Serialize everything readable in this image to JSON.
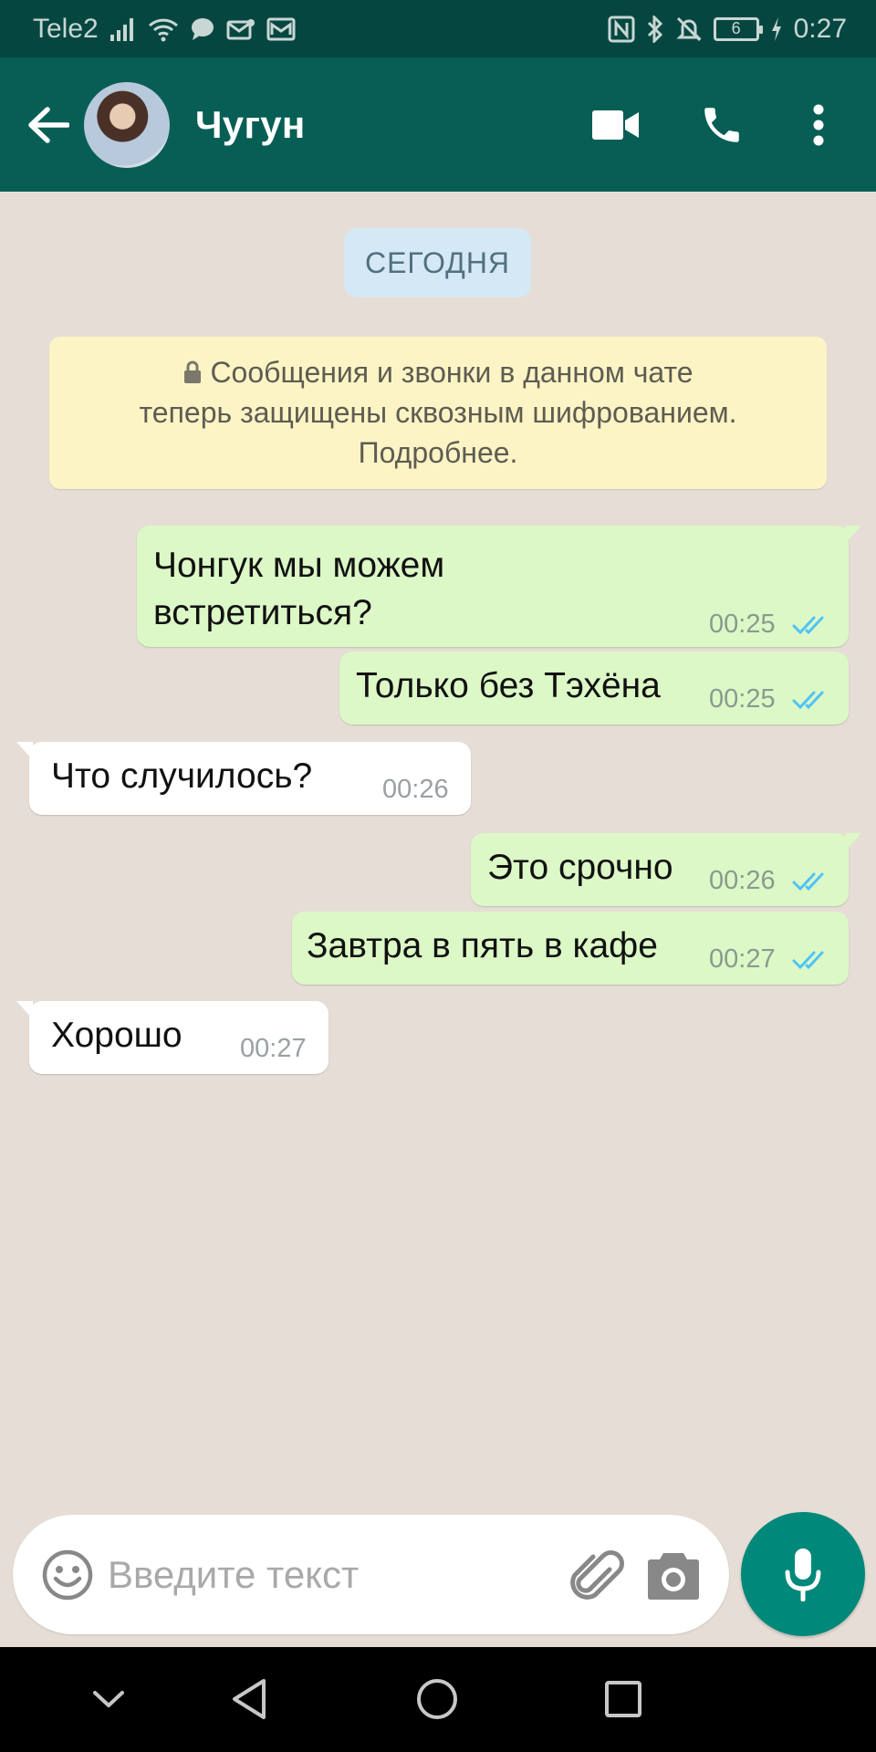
{
  "status_bar": {
    "carrier": "Tele2",
    "time": "0:27",
    "battery_level": "6"
  },
  "header": {
    "contact_name": "Чугун"
  },
  "chat": {
    "date_chip": "СЕГОДНЯ",
    "encryption_notice": {
      "line1": "Сообщения и звонки в данном чате",
      "line2": "теперь защищены сквозным шифрованием.",
      "line3": "Подробнее."
    },
    "messages": [
      {
        "direction": "out",
        "line1": "Чонгук мы можем",
        "line2": "встретиться?",
        "time": "00:25",
        "status": "read"
      },
      {
        "direction": "out",
        "line1": "Только без Тэхёна",
        "time": "00:25",
        "status": "read"
      },
      {
        "direction": "in",
        "line1": "Что случилось?",
        "time": "00:26"
      },
      {
        "direction": "out",
        "line1": "Это срочно",
        "time": "00:26",
        "status": "read"
      },
      {
        "direction": "out",
        "line1": "Завтра в пять в кафе",
        "time": "00:27",
        "status": "read"
      },
      {
        "direction": "in",
        "line1": "Хорошо",
        "time": "00:27"
      }
    ]
  },
  "composer": {
    "placeholder": "Введите текст"
  },
  "colors": {
    "header": "#075e54",
    "status_bar": "#054740",
    "outgoing_bubble": "#dcf8c6",
    "incoming_bubble": "#ffffff",
    "read_ticks": "#4fc3f7",
    "mic_button": "#00887a"
  },
  "icons": [
    "signal-icon",
    "wifi-icon",
    "chat-notification-icon",
    "mail-icon",
    "nfc-icon",
    "bluetooth-icon",
    "mute-icon",
    "battery-icon",
    "back-arrow-icon",
    "video-call-icon",
    "phone-icon",
    "more-options-icon",
    "lock-icon",
    "read-ticks-icon",
    "emoji-icon",
    "attach-icon",
    "camera-icon",
    "mic-icon",
    "nav-hide-icon",
    "nav-back-icon",
    "nav-home-icon",
    "nav-recents-icon"
  ]
}
